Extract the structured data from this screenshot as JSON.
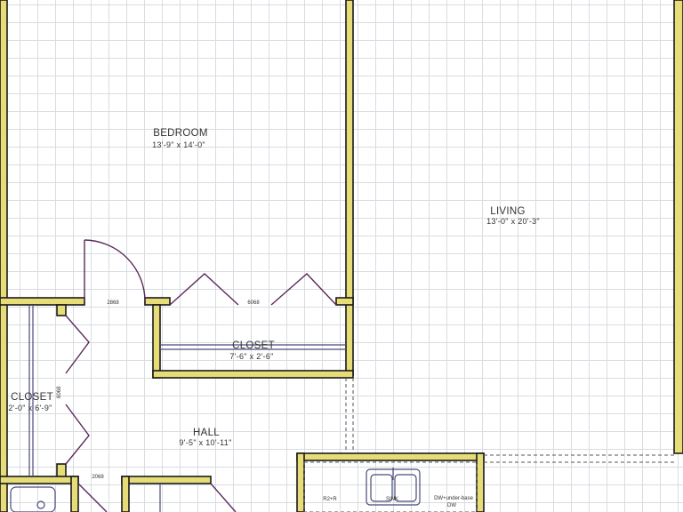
{
  "rooms": {
    "bedroom": {
      "name": "BEDROOM",
      "dims": "13'-9\" x 14'-0\""
    },
    "living": {
      "name": "LIVING",
      "dims": "13'-0\" x 20'-3\""
    },
    "closet_bedroom": {
      "name": "CLOSET",
      "dims": "7'-6\" x 2'-6\""
    },
    "closet_left": {
      "name": "CLOSET",
      "dims": "2'-0\" x 6'-9\""
    },
    "hall": {
      "name": "HALL",
      "dims": "9'-5\" x 10'-11\""
    }
  },
  "door_tags": {
    "bedroom_door": "2868",
    "closet_bifold": "6068",
    "left_closet_bifold": "6068",
    "bath_door": "2068"
  },
  "kitchen": {
    "range_tag": "R2+R",
    "sink_tag": "SINK",
    "dishwasher_tag": "DW+under-base",
    "dishwasher_tag_2": "DW"
  },
  "colors": {
    "wall_fill": "#e6dc78",
    "wall_outline": "#1a1a1a",
    "grid": "#d7dde2"
  }
}
